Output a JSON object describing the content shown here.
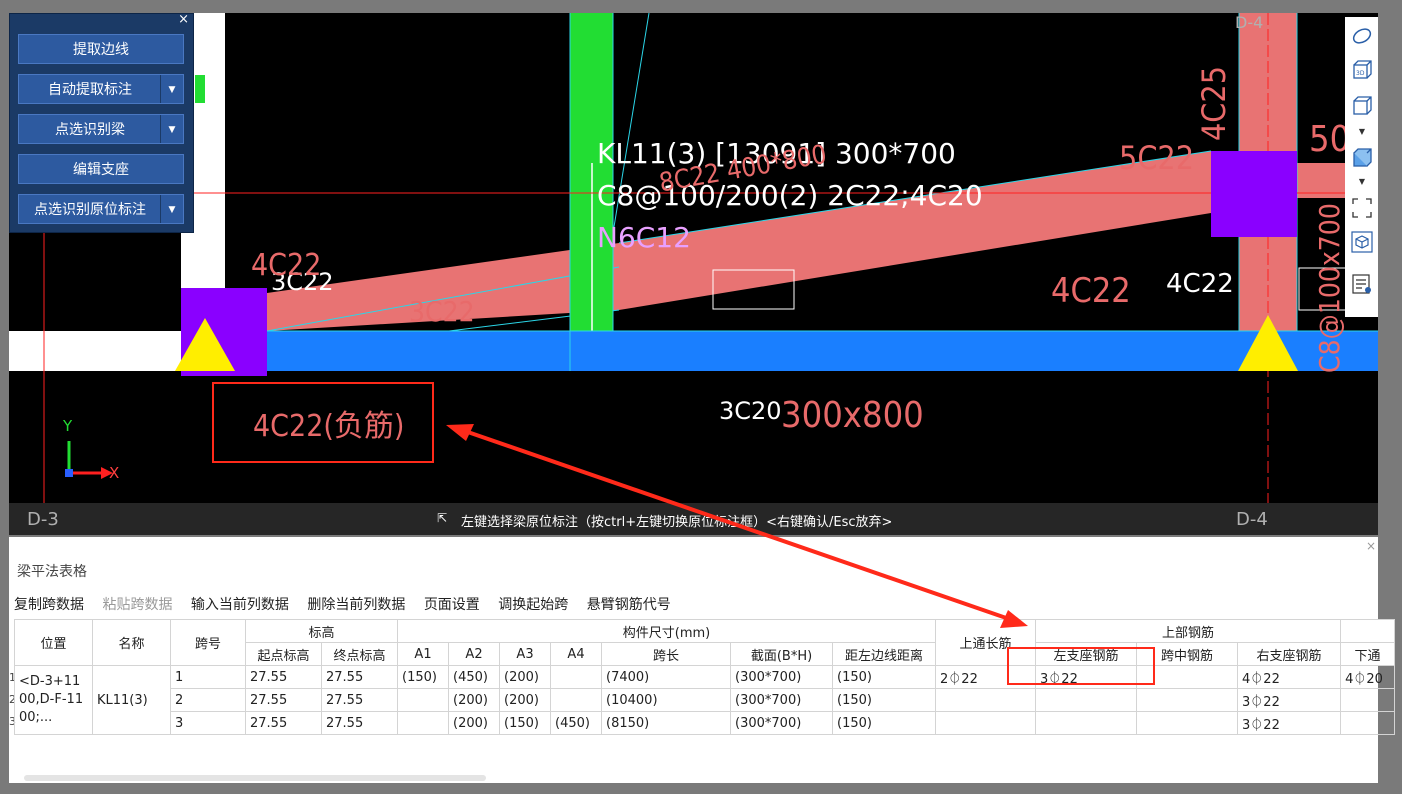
{
  "panel": {
    "close": "×",
    "buttons": [
      {
        "label": "提取边线",
        "dropdown": false
      },
      {
        "label": "自动提取标注",
        "dropdown": true
      },
      {
        "label": "点选识别梁",
        "dropdown": true
      },
      {
        "label": "编辑支座",
        "dropdown": false
      },
      {
        "label": "点选识别原位标注",
        "dropdown": true
      }
    ]
  },
  "cad": {
    "beam_label_line1": "KL11(3) [13091] 300*700",
    "beam_label_line2": "C8@100/200(2) 2C22;4C20",
    "beam_label_line3": "N6C12",
    "left_top_rebar": "3C22",
    "left_red_rebar": "4C22",
    "mid_red_rebar_a": "3C22",
    "mid_red_rebar_b": "8C22 400*800",
    "right_red_rebar": "5C22",
    "right_red_rebar2": "4C22",
    "right_white_rebar": "4C22",
    "col_red_rebar": "4C25",
    "col_red_rebar_right": "50",
    "col_red_size": "C8@100x700",
    "bottom_white_rebar": "3C20",
    "bottom_red_size": "300x800",
    "highlight_rebar": "4C22(负筋)",
    "axis_y": "Y",
    "axis_x": "X",
    "grid_left": "D-3",
    "grid_right": "D-4",
    "grid_top_right": "D-4"
  },
  "status_bar": {
    "text": "左键选择梁原位标注（按ctrl+左键切换原位标注框）<右键确认/Esc放弃>"
  },
  "toolbar_icons": [
    "orbit-icon",
    "3d-view-icon",
    "box-view-icon",
    "chevron-down-icon",
    "solid-box-icon",
    "chevron-down-icon",
    "fullscreen-icon",
    "cube-select-icon",
    "properties-icon"
  ],
  "table_panel": {
    "title": "梁平法表格",
    "close": "×",
    "toolbar": [
      "复制跨数据",
      "粘贴跨数据",
      "输入当前列数据",
      "删除当前列数据",
      "页面设置",
      "调换起始跨",
      "悬臂钢筋代号"
    ],
    "group_headers": {
      "elevation": "标高",
      "size": "构件尺寸(mm)",
      "top_rebar": "上部钢筋"
    },
    "headers": {
      "position": "位置",
      "name": "名称",
      "span_no": "跨号",
      "start_elev": "起点标高",
      "end_elev": "终点标高",
      "a1": "A1",
      "a2": "A2",
      "a3": "A3",
      "a4": "A4",
      "span_len": "跨长",
      "section": "截面(B*H)",
      "left_dist": "距左边线距离",
      "top_through": "上通长筋",
      "left_support": "左支座钢筋",
      "mid_span": "跨中钢筋",
      "right_support": "右支座钢筋",
      "bottom": "下通"
    },
    "position_value": "<D-3+1100,D-F-1100;...",
    "name_value": "KL11(3)",
    "row_numbers": [
      "1",
      "2",
      "3"
    ],
    "rows": [
      {
        "span": "1",
        "start": "27.55",
        "end": "27.55",
        "a1": "(150)",
        "a2": "(450)",
        "a3": "(200)",
        "a4": "",
        "len": "(7400)",
        "section": "(300*700)",
        "dist": "(150)",
        "through": "2⏀22",
        "left": "3⏀22",
        "mid": "",
        "right": "4⏀22",
        "bottom": "4⏀20"
      },
      {
        "span": "2",
        "start": "27.55",
        "end": "27.55",
        "a1": "",
        "a2": "(200)",
        "a3": "(200)",
        "a4": "",
        "len": "(10400)",
        "section": "(300*700)",
        "dist": "(150)",
        "through": "",
        "left": "",
        "mid": "",
        "right": "3⏀22",
        "bottom": ""
      },
      {
        "span": "3",
        "start": "27.55",
        "end": "27.55",
        "a1": "",
        "a2": "(200)",
        "a3": "(150)",
        "a4": "(450)",
        "len": "(8150)",
        "section": "(300*700)",
        "dist": "(150)",
        "through": "",
        "left": "",
        "mid": "",
        "right": "3⏀22",
        "bottom": ""
      }
    ]
  },
  "colors": {
    "beam_fill": "#e87373",
    "column_fill": "#8a00ff",
    "support_marker": "#ffee00",
    "blue_beam": "#1a7fff",
    "green_column": "#22dd33",
    "highlight_box": "#ff2a1a"
  }
}
